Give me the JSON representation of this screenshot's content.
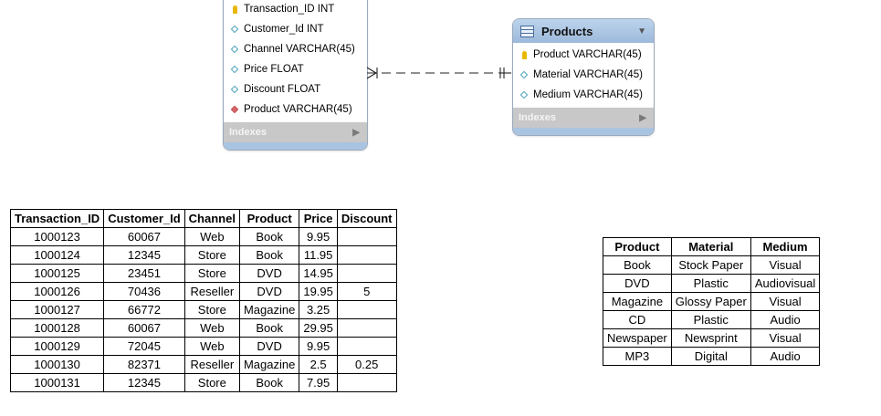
{
  "transactions_entity": {
    "columns": [
      {
        "marker": "key",
        "label": "Transaction_ID INT"
      },
      {
        "marker": "attr",
        "label": "Customer_Id INT"
      },
      {
        "marker": "attr",
        "label": "Channel VARCHAR(45)"
      },
      {
        "marker": "attr",
        "label": "Price FLOAT"
      },
      {
        "marker": "attr",
        "label": "Discount FLOAT"
      },
      {
        "marker": "fk",
        "label": "Product VARCHAR(45)"
      }
    ],
    "indexes_label": "Indexes"
  },
  "products_entity": {
    "title": "Products",
    "columns": [
      {
        "marker": "key",
        "label": "Product VARCHAR(45)"
      },
      {
        "marker": "attr",
        "label": "Material VARCHAR(45)"
      },
      {
        "marker": "attr",
        "label": "Medium VARCHAR(45)"
      }
    ],
    "indexes_label": "Indexes"
  },
  "transactions_table": {
    "headers": [
      "Transaction_ID",
      "Customer_Id",
      "Channel",
      "Product",
      "Price",
      "Discount"
    ],
    "rows": [
      [
        "1000123",
        "60067",
        "Web",
        "Book",
        "9.95",
        ""
      ],
      [
        "1000124",
        "12345",
        "Store",
        "Book",
        "11.95",
        ""
      ],
      [
        "1000125",
        "23451",
        "Store",
        "DVD",
        "14.95",
        ""
      ],
      [
        "1000126",
        "70436",
        "Reseller",
        "DVD",
        "19.95",
        "5"
      ],
      [
        "1000127",
        "66772",
        "Store",
        "Magazine",
        "3.25",
        ""
      ],
      [
        "1000128",
        "60067",
        "Web",
        "Book",
        "29.95",
        ""
      ],
      [
        "1000129",
        "72045",
        "Web",
        "DVD",
        "9.95",
        ""
      ],
      [
        "1000130",
        "82371",
        "Reseller",
        "Magazine",
        "2.5",
        "0.25"
      ],
      [
        "1000131",
        "12345",
        "Store",
        "Book",
        "7.95",
        ""
      ]
    ]
  },
  "products_table": {
    "headers": [
      "Product",
      "Material",
      "Medium"
    ],
    "rows": [
      [
        "Book",
        "Stock Paper",
        "Visual"
      ],
      [
        "DVD",
        "Plastic",
        "Audiovisual"
      ],
      [
        "Magazine",
        "Glossy Paper",
        "Visual"
      ],
      [
        "CD",
        "Plastic",
        "Audio"
      ],
      [
        "Newspaper",
        "Newsprint",
        "Visual"
      ],
      [
        "MP3",
        "Digital",
        "Audio"
      ]
    ]
  }
}
